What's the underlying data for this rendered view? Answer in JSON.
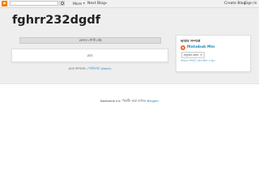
{
  "navbar": {
    "search_placeholder": "",
    "more_label": "More",
    "next_blog_label": "Next Blog»",
    "create_blog_label": "Create Blog",
    "sign_in_label": "Sign In",
    "logo_icon": "blogger-logo-icon",
    "search_icon": "search-icon"
  },
  "blog": {
    "title": "fghrr232dgdf"
  },
  "main": {
    "status_message": "কোনও পোস্ট নেই৷",
    "home_label": "হোম",
    "subscribe_prefix": "এতে সদস্যতা:",
    "subscribe_link": "পোস্টগুলি (Atom)"
  },
  "sidebar": {
    "widget_title": "আমার সম্পর্কে",
    "profile_name": "Mahabub Mm",
    "follow_label": "অনুসরণ করুন",
    "full_profile_link": "আমার সম্পূর্ণ প্রোফাইল দেখুন"
  },
  "footer": {
    "attribution_prefix": "Awesome Inc. থিমটি। ",
    "attribution_middle": "দ্বারা চালিত ",
    "attribution_link": "Blogger"
  },
  "colors": {
    "accent_link": "#2288bb",
    "blogger_orange": "#f57d00",
    "profile_orange": "#f06a35",
    "page_bg": "#eeeeee"
  }
}
